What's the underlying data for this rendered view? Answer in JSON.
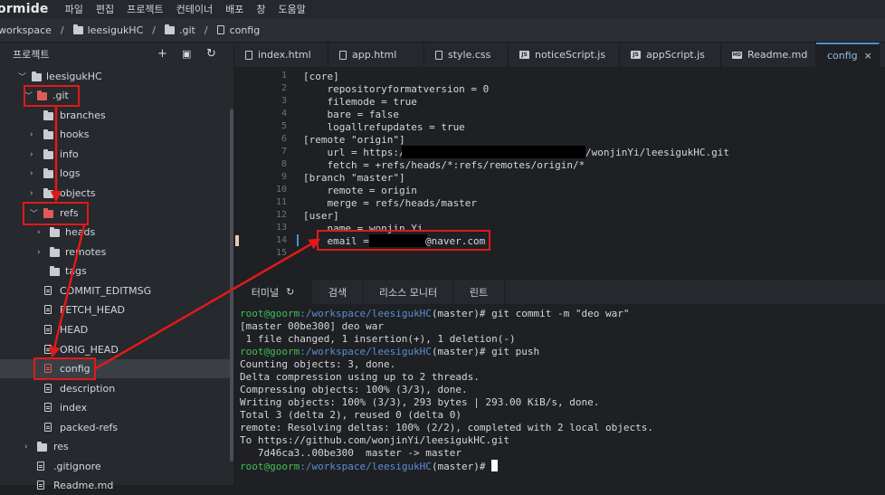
{
  "app": {
    "brand": "ormide"
  },
  "menu": [
    "파일",
    "편집",
    "프로젝트",
    "컨테이너",
    "배포",
    "창",
    "도움말"
  ],
  "path": [
    "workspace",
    "leesigukHC",
    ".git",
    "config"
  ],
  "sidebar": {
    "title": "프로젝트",
    "tools": [
      "+",
      "▣",
      "↻"
    ],
    "items": [
      {
        "label": "leesigukHC",
        "type": "folder",
        "open": true
      },
      {
        "label": ".git",
        "type": "folder",
        "open": true,
        "highlight": true
      },
      {
        "label": "branches",
        "type": "folder"
      },
      {
        "label": "hooks",
        "type": "folder"
      },
      {
        "label": "info",
        "type": "folder"
      },
      {
        "label": "logs",
        "type": "folder"
      },
      {
        "label": "objects",
        "type": "folder"
      },
      {
        "label": "refs",
        "type": "folder",
        "open": true,
        "highlight": true
      },
      {
        "label": "heads",
        "type": "folder"
      },
      {
        "label": "remotes",
        "type": "folder"
      },
      {
        "label": "tags",
        "type": "folder"
      },
      {
        "label": "COMMIT_EDITMSG",
        "type": "file"
      },
      {
        "label": "FETCH_HEAD",
        "type": "file"
      },
      {
        "label": "HEAD",
        "type": "file"
      },
      {
        "label": "ORIG_HEAD",
        "type": "file"
      },
      {
        "label": "config",
        "type": "file",
        "selected": true,
        "highlight": true
      },
      {
        "label": "description",
        "type": "file"
      },
      {
        "label": "index",
        "type": "file"
      },
      {
        "label": "packed-refs",
        "type": "file"
      },
      {
        "label": "res",
        "type": "folder"
      },
      {
        "label": ".gitignore",
        "type": "file"
      },
      {
        "label": "Readme.md",
        "type": "file"
      }
    ]
  },
  "tabs": [
    {
      "label": "index.html",
      "icon": "html-file-icon"
    },
    {
      "label": "app.html",
      "icon": "html-file-icon"
    },
    {
      "label": "style.css",
      "icon": "css-file-icon"
    },
    {
      "label": "noticeScript.js",
      "icon": "js-file-icon"
    },
    {
      "label": "appScript.js",
      "icon": "js-file-icon"
    },
    {
      "label": "Readme.md",
      "icon": "md-file-icon"
    },
    {
      "label": "config",
      "icon": "",
      "active": true,
      "close": "×"
    }
  ],
  "editor": {
    "lines": [
      "[core]",
      "    repositoryformatversion = 0",
      "    filemode = true",
      "    bare = false",
      "    logallrefupdates = true",
      "[remote \"origin\"]",
      "    url = https:/",
      "    fetch = +refs/heads/*:refs/remotes/origin/*",
      "[branch \"master\"]",
      "    remote = origin",
      "    merge = refs/heads/master",
      "[user]",
      "    name = wonjin Yi",
      "    email = ",
      ""
    ],
    "line_numbers": [
      "1",
      "2",
      "3",
      "4",
      "5",
      "6",
      "7",
      "8",
      "9",
      "10",
      "11",
      "12",
      "13",
      "14",
      "15"
    ],
    "url_tail": "/wonjinYi/leesigukHC.git",
    "email_tail": "@naver.com"
  },
  "terminal": {
    "tabs": [
      "터미널",
      "검색",
      "리소스 모니터",
      "린트"
    ],
    "terminal_icon": "↻",
    "prompt_user": "root@goorm",
    "prompt_path": ":/workspace/leesigukHC",
    "prompt_branch": "(master)#",
    "lines": [
      {
        "prompt": true,
        "cmd": " git commit -m \"deo war\""
      },
      {
        "text": "[master 00be300] deo war"
      },
      {
        "text": " 1 file changed, 1 insertion(+), 1 deletion(-)"
      },
      {
        "prompt": true,
        "cmd": " git push"
      },
      {
        "text": "Counting objects: 3, done."
      },
      {
        "text": "Delta compression using up to 2 threads."
      },
      {
        "text": "Compressing objects: 100% (3/3), done."
      },
      {
        "text": "Writing objects: 100% (3/3), 293 bytes | 293.00 KiB/s, done."
      },
      {
        "text": "Total 3 (delta 2), reused 0 (delta 0)"
      },
      {
        "text": "remote: Resolving deltas: 100% (2/2), completed with 2 local objects."
      },
      {
        "text": "To https://github.com/wonjinYi/leesigukHC.git"
      },
      {
        "text": "   7d46ca3..00be300  master -> master"
      },
      {
        "prompt": true,
        "cmd": " "
      }
    ]
  },
  "colors": {
    "highlight": "#e01a1a",
    "prompt": "#3fc056",
    "path": "#5a8fd6",
    "active_tab": "#8fbce6"
  }
}
